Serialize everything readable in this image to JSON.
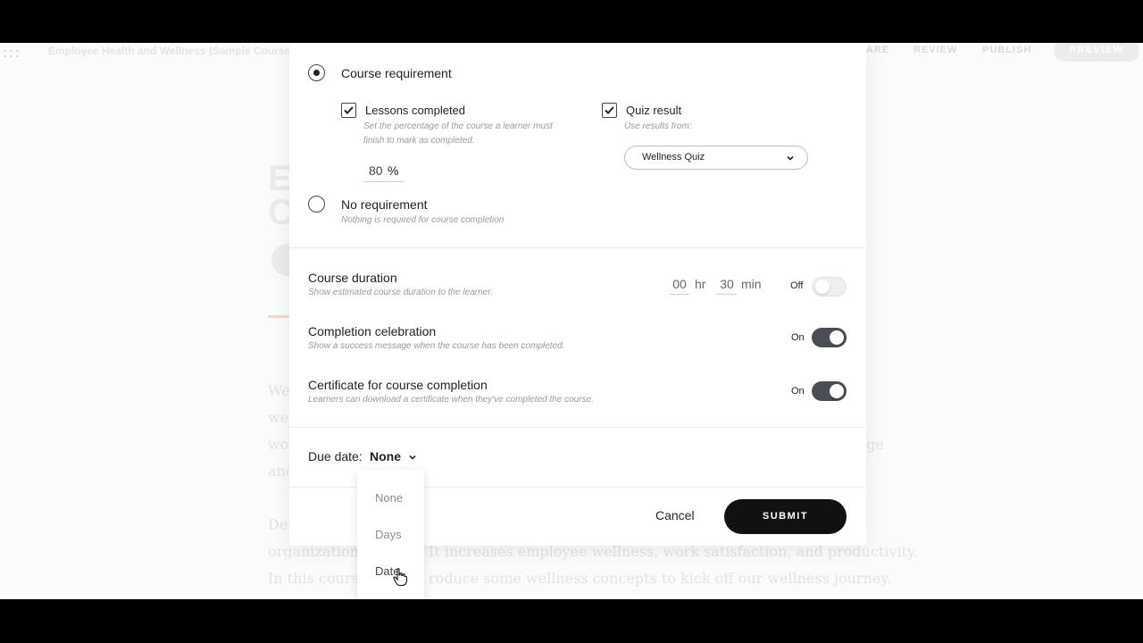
{
  "background": {
    "course_title": "Employee Health and Wellness (Sample Course)",
    "nav": [
      "ARE",
      "REVIEW",
      "PUBLISH"
    ],
    "preview_label": "PREVIEW",
    "big_letters": [
      "E",
      "C"
    ],
    "para_lines": [
      "We",
      "wel",
      "wo",
      "and",
      "Dev"
    ],
    "para_right": "ge",
    "line_org": "organization",
    "line_org_rest": "It increases employee wellness, work satisfaction, and productivity.",
    "line_course": "In this course",
    "line_course_rest": "roduce some wellness concepts to kick off our wellness journey."
  },
  "completion": {
    "course_requirement_label": "Course requirement",
    "lessons_completed_label": "Lessons completed",
    "lessons_hint_1": "Set the percentage of the course a learner must",
    "lessons_hint_2": "finish to mark as completed.",
    "percent_value": "80",
    "percent_unit": "%",
    "quiz_result_label": "Quiz result",
    "quiz_hint": "Use results from:",
    "quiz_selected": "Wellness Quiz",
    "no_requirement_label": "No requirement",
    "no_requirement_hint": "Nothing is required for course completion"
  },
  "settings": {
    "duration_label": "Course duration",
    "duration_hint": "Show estimated course duration to the learner.",
    "hours": "00",
    "hours_unit": "hr",
    "minutes": "30",
    "minutes_unit": "min",
    "duration_toggle": "Off",
    "celebration_label": "Completion celebration",
    "celebration_hint": "Show a success message when the course has been completed.",
    "celebration_toggle": "On",
    "certificate_label": "Certificate for course completion",
    "certificate_hint": "Learners can download a certificate when they've completed the course.",
    "certificate_toggle": "On"
  },
  "due_date": {
    "label": "Due date:",
    "value": "None",
    "options": [
      "None",
      "Days",
      "Date"
    ]
  },
  "actions": {
    "cancel": "Cancel",
    "submit": "SUBMIT"
  }
}
